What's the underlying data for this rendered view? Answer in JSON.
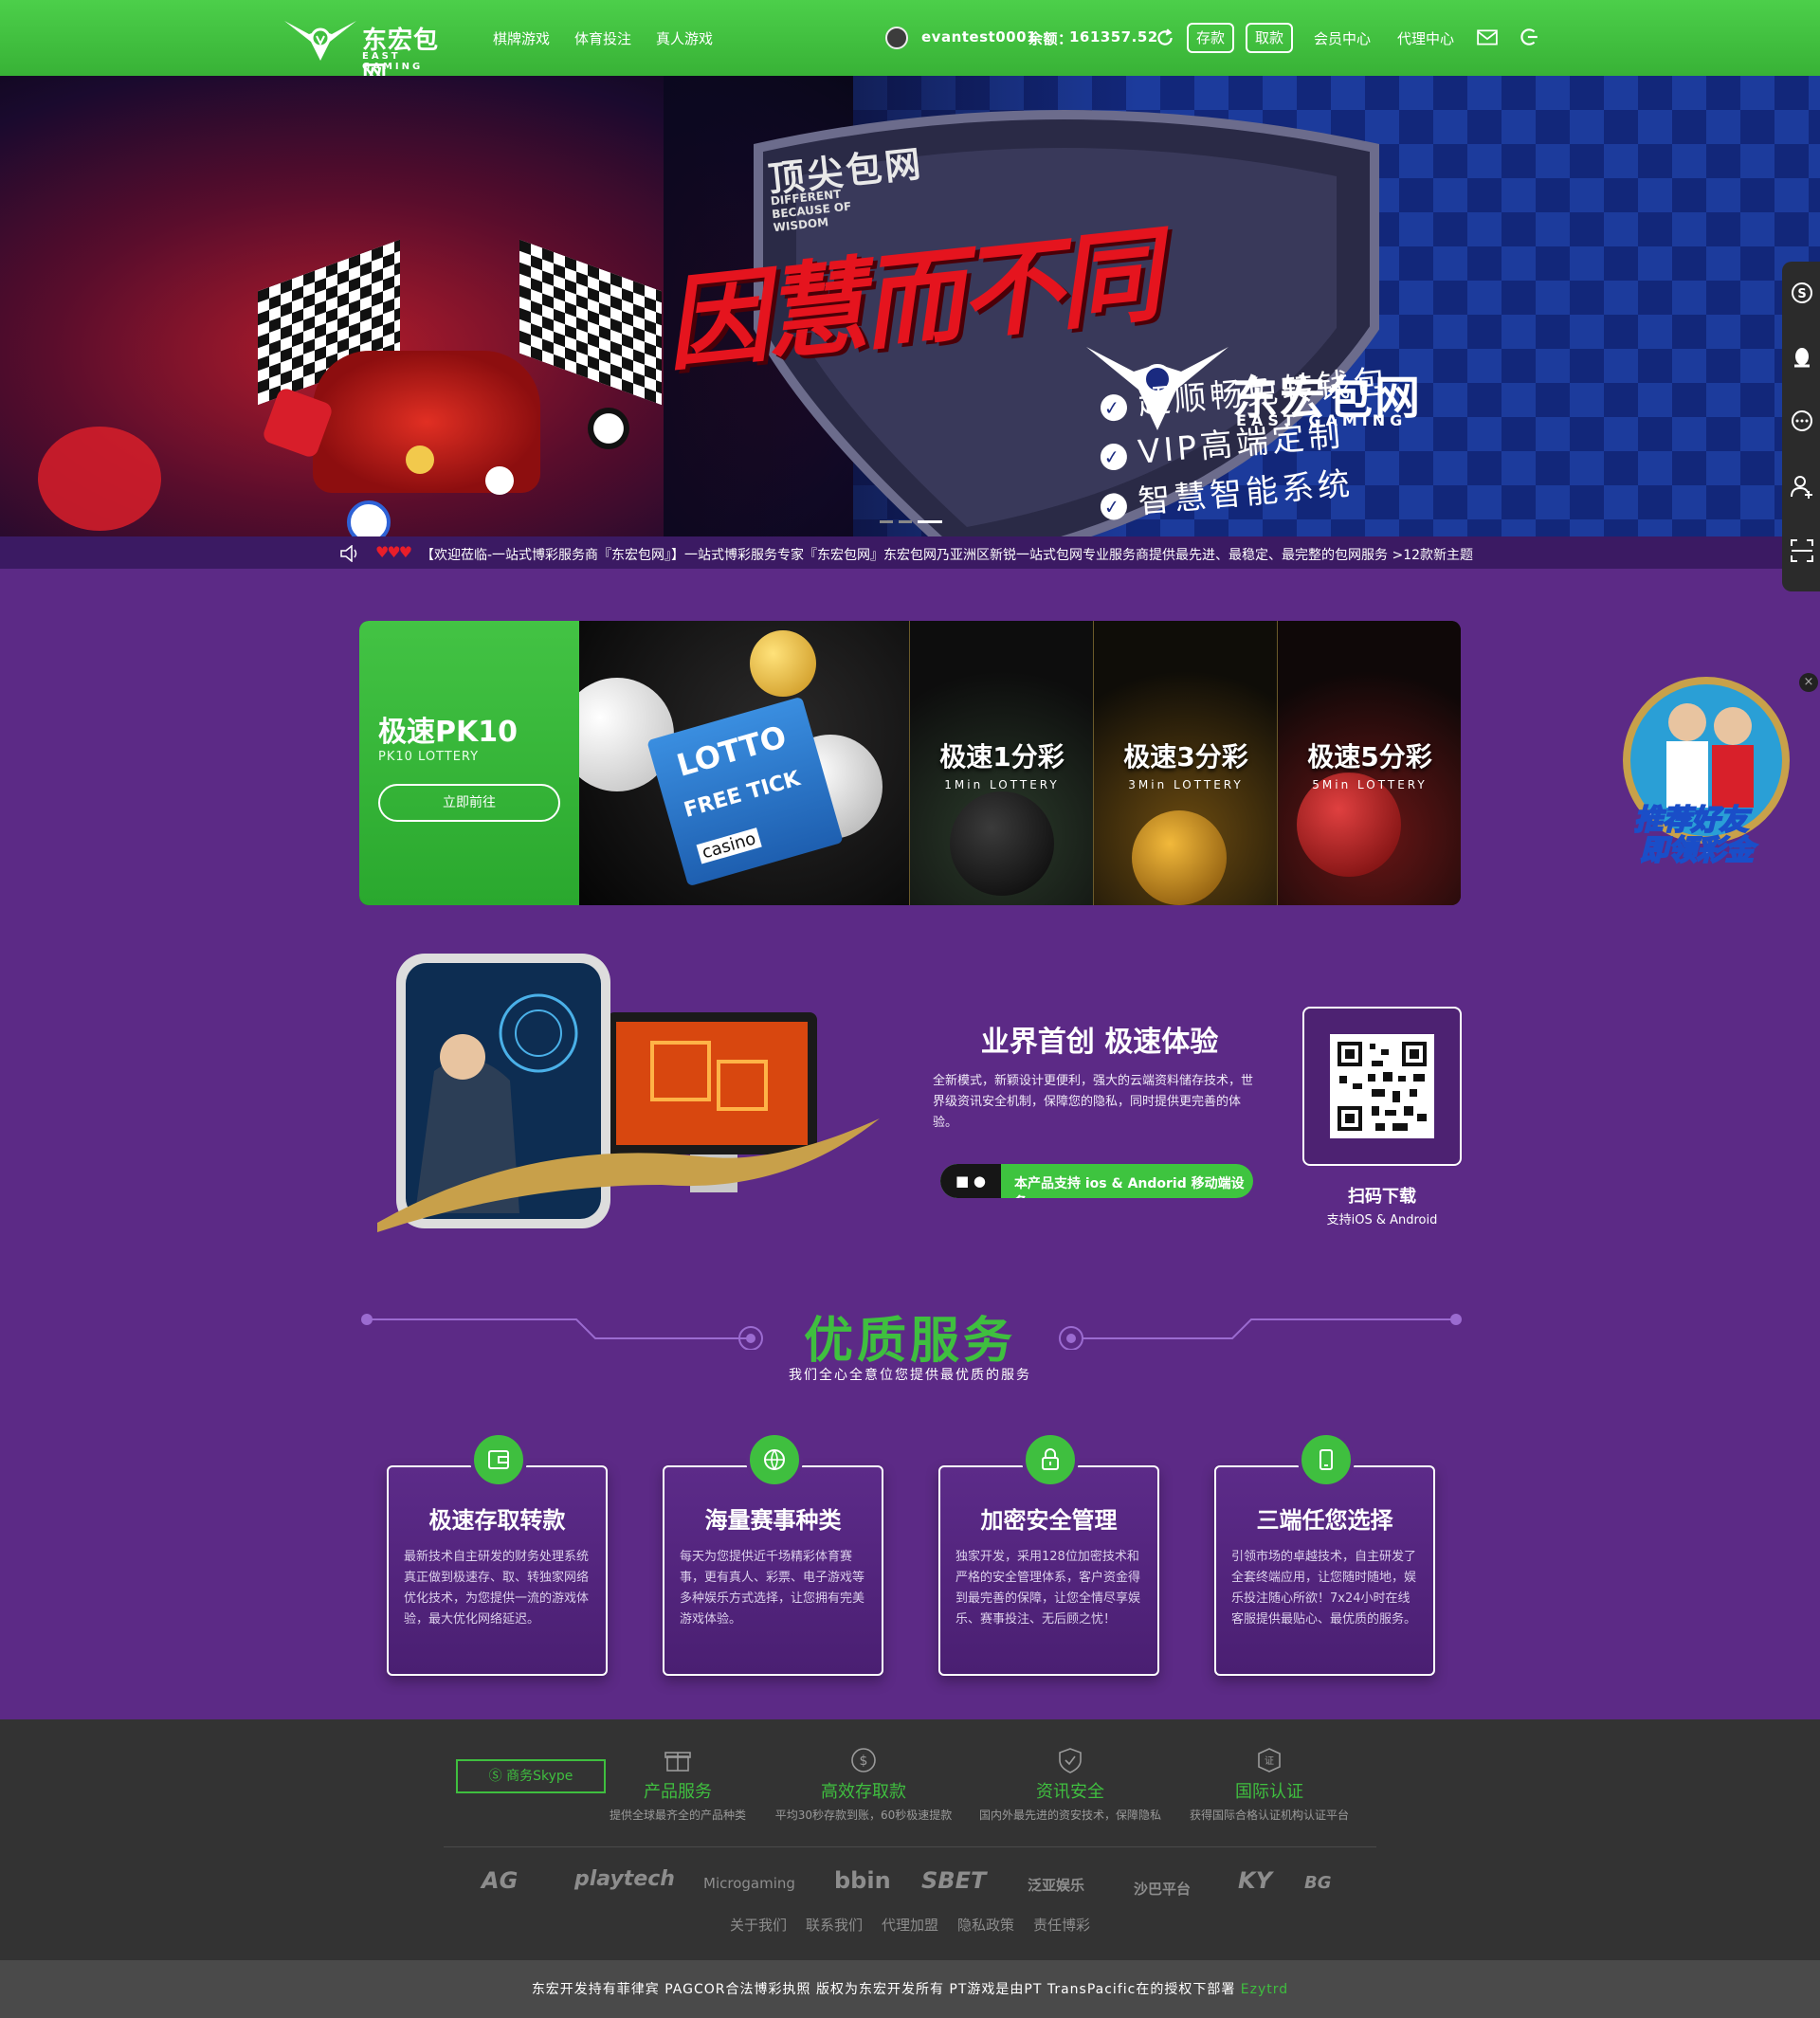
{
  "header": {
    "logo_cn": "东宏包网",
    "logo_en": "EAST GAMING",
    "nav": [
      "棋牌游戏",
      "体育投注",
      "真人游戏"
    ],
    "username": "evantest0001",
    "balance_label": "余额：",
    "balance": "161357.52",
    "deposit": "存款",
    "withdraw": "取款",
    "member_center": "会员中心",
    "agent_center": "代理中心"
  },
  "banner": {
    "cn1": "顶尖包网",
    "en1": "DIFFERENT BECAUSE OF WISDOM",
    "main": "因慧而不同",
    "brand": "东宏包网",
    "brand_en": "EAST GAMING",
    "features": [
      "超顺畅免转钱包",
      "VIP高端定制",
      "智慧智能系统"
    ]
  },
  "marquee": {
    "text": "【欢迎莅临-一站式博彩服务商『东宏包网』】一站式博彩服务专家『东宏包网』东宏包网乃亚洲区新锐一站式包网专业服务商提供最先进、最稳定、最完整的包网服务 >12款新主题"
  },
  "lottery": {
    "featured": {
      "title": "极速PK10",
      "sub": "PK10 LOTTERY",
      "button": "立即前往"
    },
    "ticket": {
      "lotto": "LOTTO",
      "free": "FREE TICK",
      "casino": "casino"
    },
    "panels": [
      {
        "title": "极速1分彩",
        "sub": "1Min LOTTERY"
      },
      {
        "title": "极速3分彩",
        "sub": "3Min LOTTERY"
      },
      {
        "title": "极速5分彩",
        "sub": "5Min LOTTERY"
      }
    ]
  },
  "app": {
    "title": "业界首创 极速体验",
    "desc": "全新模式，新颖设计更便利，强大的云端资料储存技术，世界级资讯安全机制，保障您的隐私，同时提供更完善的体验。",
    "support": "本产品支持 ios & Andorid 移动端设备",
    "qr_title": "扫码下载",
    "qr_sub": "支持iOS & Android"
  },
  "services": {
    "title": "优质服务",
    "subtitle": "我们全心全意位您提供最优质的服务",
    "cards": [
      {
        "title": "极速存取转款",
        "icon": "wallet-icon",
        "desc": "最新技术自主研发的财务处理系统真正做到极速存、取、转独家网络优化技术，为您提供一流的游戏体验，最大优化网络延迟。"
      },
      {
        "title": "海量赛事种类",
        "icon": "basketball-icon",
        "desc": "每天为您提供近千场精彩体育赛事，更有真人、彩票、电子游戏等多种娱乐方式选择，让您拥有完美游戏体验。"
      },
      {
        "title": "加密安全管理",
        "icon": "lock-icon",
        "desc": "独家开发，采用128位加密技术和严格的安全管理体系，客户资金得到最完善的保障，让您全情尽享娱乐、赛事投注、无后顾之忧！"
      },
      {
        "title": "三端任您选择",
        "icon": "mobile-icon",
        "desc": "引领市场的卓越技术，自主研发了全套终端应用，让您随时随地，娱乐投注随心所欲！7x24小时在线客服提供最贴心、最优质的服务。"
      }
    ]
  },
  "footer": {
    "skype": "商务Skype",
    "items": [
      {
        "title": "产品服务",
        "sub": "提供全球最齐全的产品种类",
        "icon": "gift-icon"
      },
      {
        "title": "高效存取款",
        "sub": "平均30秒存款到账，60秒极速提款",
        "icon": "dollar-icon"
      },
      {
        "title": "资讯安全",
        "sub": "国内外最先进的资安技术，保障隐私",
        "icon": "shield-icon"
      },
      {
        "title": "国际认证",
        "sub": "获得国际合格认证机构认证平台",
        "icon": "certificate-icon"
      }
    ],
    "partners": [
      "AG",
      "playtech",
      "Microgaming",
      "bbin",
      "SBET",
      "泛亚娱乐",
      "沙巴平台",
      "KY",
      "BG"
    ],
    "links": [
      "关于我们",
      "联系我们",
      "代理加盟",
      "隐私政策",
      "责任博彩"
    ],
    "copyright": "东宏开发持有菲律宾 PAGCOR合法博彩执照 版权为东宏开发所有 PT游戏是由PT TransPacific在的授权下部署",
    "copyright_link": "Ezytrd"
  },
  "promo": {
    "line1": "推荐好友",
    "line2": "即领彩金",
    "close": "×"
  },
  "colors": {
    "header_green": "#3fbf3f",
    "page_purple": "#5c2a86",
    "accent_green": "#3fbf3f",
    "footer_dark": "#333333"
  }
}
